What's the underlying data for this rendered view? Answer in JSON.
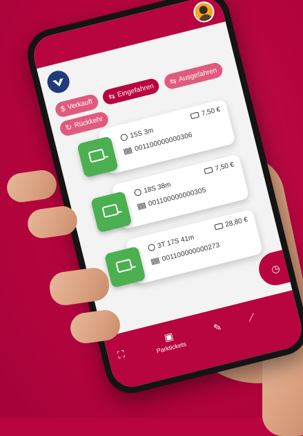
{
  "filters": [
    {
      "label": "Verkauft",
      "icon": "$",
      "active": false
    },
    {
      "label": "Eingefahren",
      "icon": "⇆",
      "active": true
    },
    {
      "label": "Ausgefahren",
      "icon": "⇆",
      "active": false
    },
    {
      "label": "Rückkehr",
      "icon": "↻",
      "active": false
    }
  ],
  "tickets": [
    {
      "duration": "15S 3m",
      "price": "7,50 €",
      "code": "001100000000306"
    },
    {
      "duration": "18S 38m",
      "price": "7,50 €",
      "code": "001100000000305"
    },
    {
      "duration": "3T 17S 41m",
      "price": "28,80 €",
      "code": "001100000000273"
    }
  ],
  "nav": {
    "active_label": "Parktickets"
  },
  "colors": {
    "brand": "#b8043f",
    "accent": "#4caf50"
  }
}
